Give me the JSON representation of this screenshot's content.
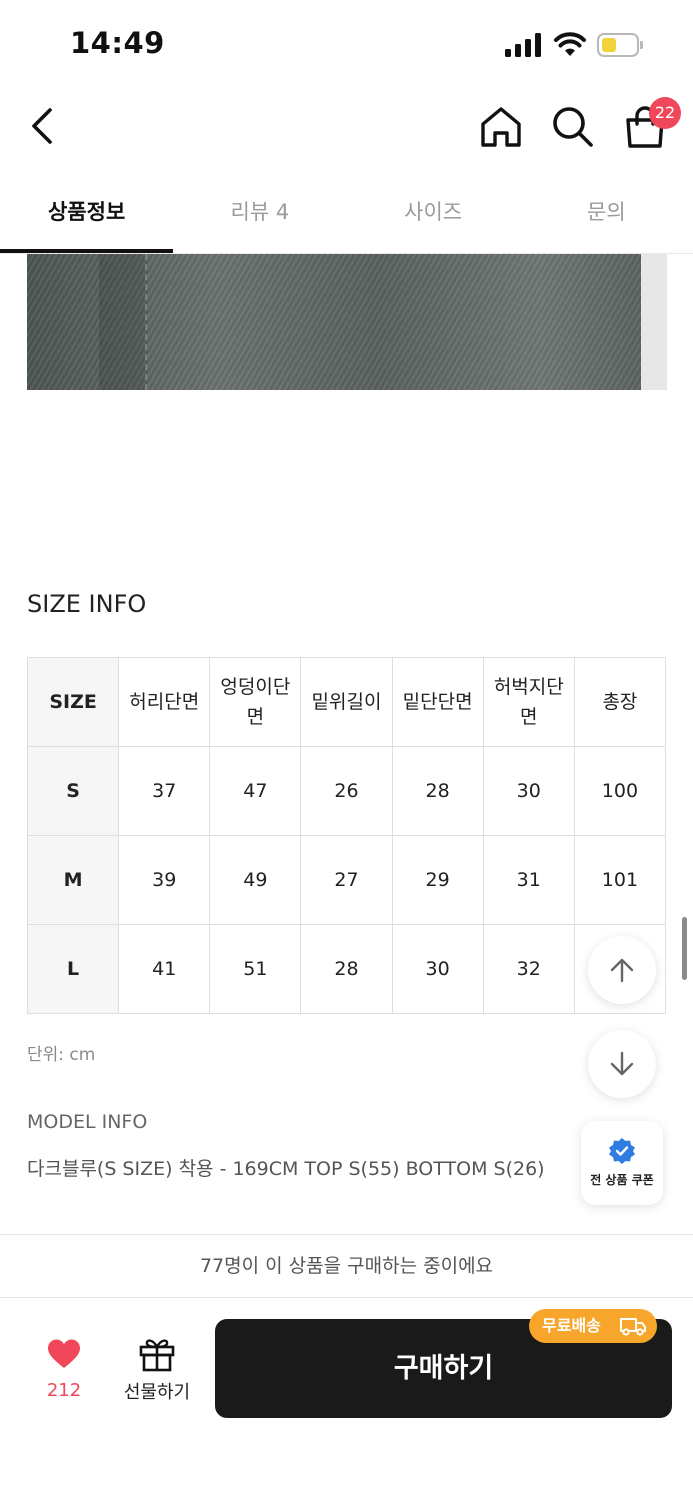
{
  "status_bar": {
    "time": "14:49"
  },
  "nav": {
    "cart_count": "22",
    "icons": [
      "back-icon",
      "home-icon",
      "search-icon",
      "shopping-bag-icon"
    ]
  },
  "tabs": [
    {
      "label": "상품정보",
      "active": true
    },
    {
      "label": "리뷰 4",
      "active": false
    },
    {
      "label": "사이즈",
      "active": false
    },
    {
      "label": "문의",
      "active": false
    }
  ],
  "size_info": {
    "title": "SIZE INFO",
    "headers": [
      "SIZE",
      "허리단면",
      "엉덩이단면",
      "밑위길이",
      "밑단단면",
      "허벅지단면",
      "총장"
    ],
    "rows": [
      [
        "S",
        "37",
        "47",
        "26",
        "28",
        "30",
        "100"
      ],
      [
        "M",
        "39",
        "49",
        "27",
        "29",
        "31",
        "101"
      ],
      [
        "L",
        "41",
        "51",
        "28",
        "30",
        "32",
        ""
      ]
    ],
    "unit": "단위: cm"
  },
  "model_info": {
    "title": "MODEL INFO",
    "text": "다크블루(S SIZE) 착용 - 169CM TOP S(55) BOTTOM S(26)"
  },
  "floating": {
    "coupon_label": "전 상품 쿠폰"
  },
  "purchase_notice": "77명이 이 상품을 구매하는 중이에요",
  "bottom_bar": {
    "like_count": "212",
    "gift_label": "선물하기",
    "buy_label": "구매하기",
    "free_shipping_label": "무료배송"
  },
  "colors": {
    "accent_red": "#f0475a",
    "buy_button": "#1a1a1a",
    "free_shipping": "#f7a52b",
    "verified_blue": "#2f7de1"
  }
}
